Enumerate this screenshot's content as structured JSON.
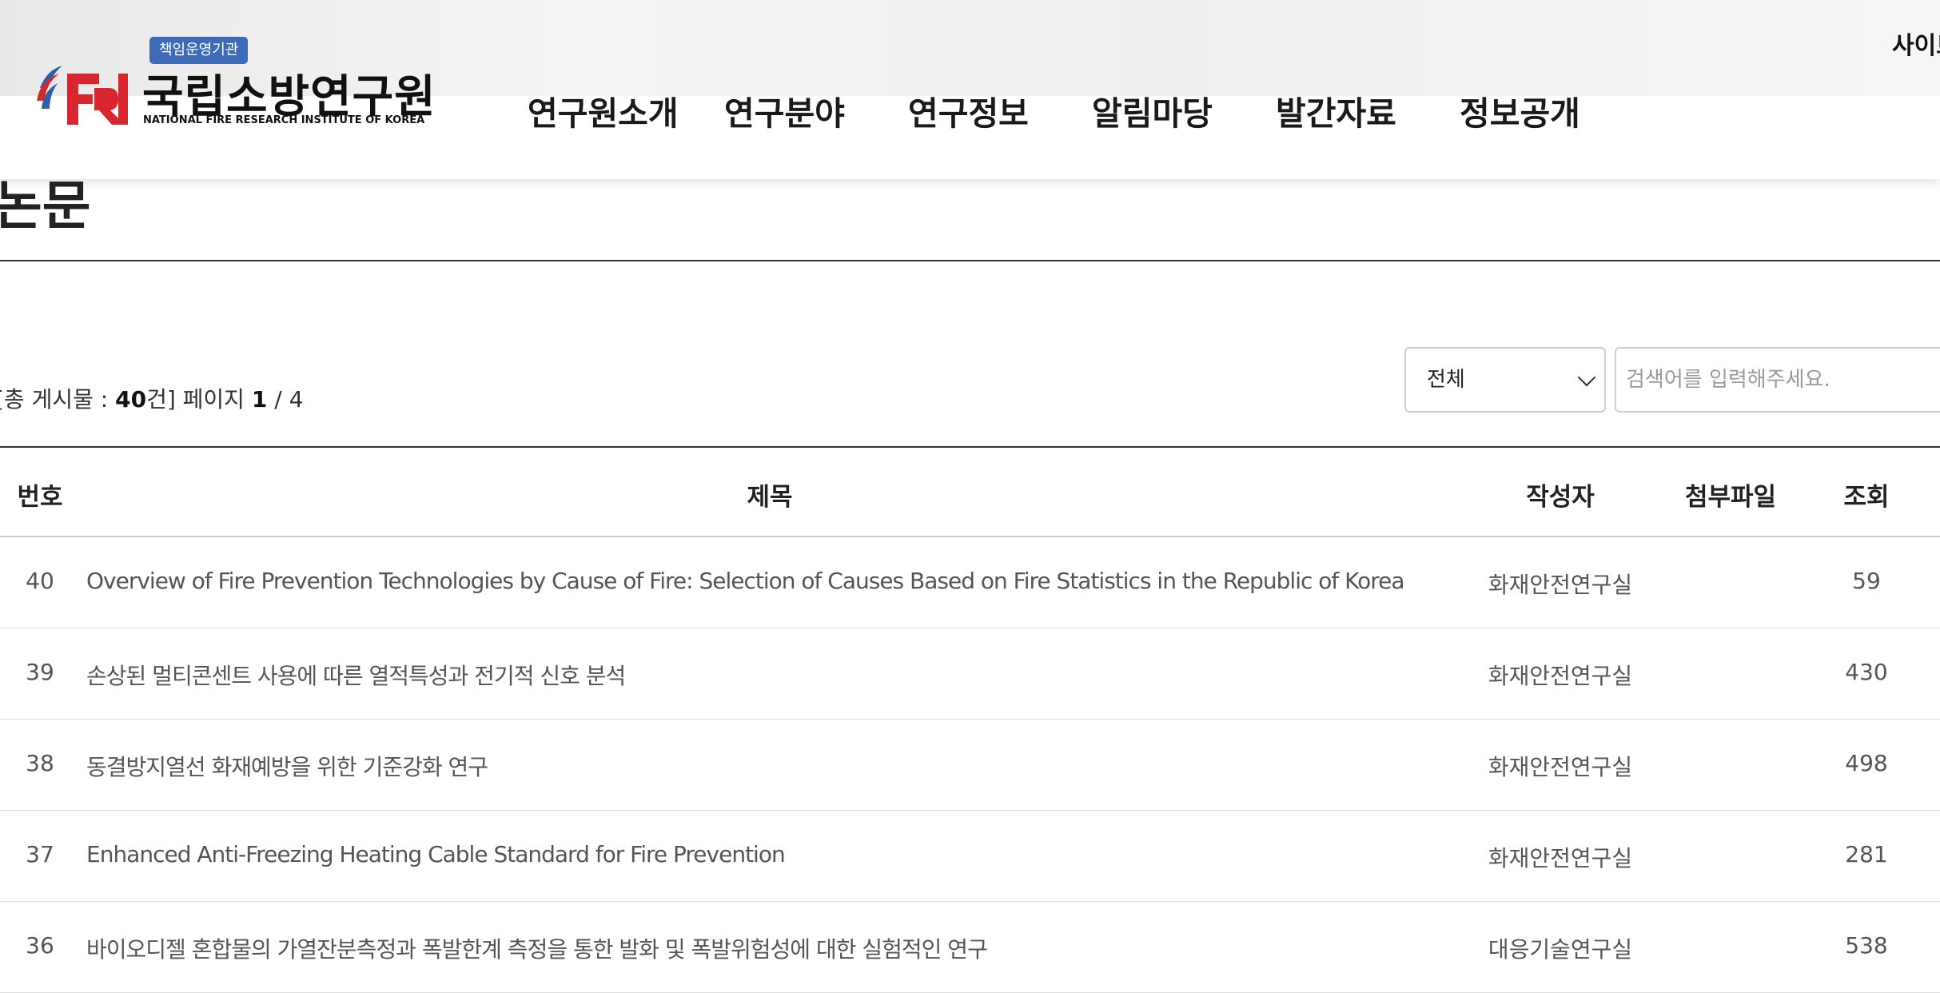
{
  "header": {
    "utility_link": "사이트맵",
    "logo": {
      "badge": "책임운영기관",
      "name": "국립소방연구원",
      "english": "NATIONAL FIRE RESEARCH INSTITUTE OF KOREA"
    },
    "nav": [
      "연구원소개",
      "연구분야",
      "연구정보",
      "알림마당",
      "발간자료",
      "정보공개"
    ]
  },
  "page": {
    "title": "논문"
  },
  "board": {
    "info_prefix": "[총 게시물 : ",
    "total": "40",
    "info_mid": "건] 페이지 ",
    "page": "1",
    "info_sep": " / ",
    "pages": "4"
  },
  "search": {
    "select_value": "전체",
    "placeholder": "검색어를 입력해주세요."
  },
  "table": {
    "headers": {
      "no": "번호",
      "title": "제목",
      "author": "작성자",
      "attach": "첨부파일",
      "views": "조회"
    },
    "rows": [
      {
        "no": "40",
        "title": "Overview of Fire Prevention Technologies by Cause of Fire: Selection of Causes Based on Fire Statistics in the Republic of Korea",
        "author": "화재안전연구실",
        "views": "59"
      },
      {
        "no": "39",
        "title": "손상된 멀티콘센트 사용에 따른 열적특성과 전기적 신호 분석",
        "author": "화재안전연구실",
        "views": "430"
      },
      {
        "no": "38",
        "title": "동결방지열선 화재예방을 위한 기준강화 연구",
        "author": "화재안전연구실",
        "views": "498"
      },
      {
        "no": "37",
        "title": "Enhanced Anti-Freezing Heating Cable Standard for Fire Prevention",
        "author": "화재안전연구실",
        "views": "281"
      },
      {
        "no": "36",
        "title": "바이오디젤 혼합물의 가열잔분측정과 폭발한계 측정을 통한 발화 및 폭발위험성에 대한 실험적인 연구",
        "author": "대응기술연구실",
        "views": "538"
      }
    ]
  },
  "colors": {
    "logo_red": "#d7262e",
    "logo_blue": "#2d5fa8",
    "badge": "#3d6bb8"
  }
}
